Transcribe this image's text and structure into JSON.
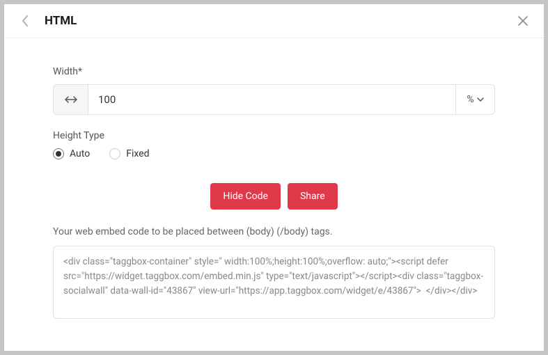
{
  "header": {
    "title": "HTML"
  },
  "form": {
    "width_label": "Width*",
    "width_value": "100",
    "width_unit": "%",
    "height_type_label": "Height Type",
    "radio_auto": "Auto",
    "radio_fixed": "Fixed"
  },
  "buttons": {
    "hide_code": "Hide Code",
    "share": "Share"
  },
  "embed": {
    "description": "Your web embed code to be placed between (body) (/body) tags.",
    "code": "<div class=\"taggbox-container\" style=\" width:100%;height:100%;overflow: auto;\"><script defer src=\"https://widget.taggbox.com/embed.min.js\" type=\"text/javascript\"></script><div class=\"taggbox-socialwall\" data-wall-id=\"43867\" view-url=\"https://app.taggbox.com/widget/e/43867\">  </div></div>"
  }
}
